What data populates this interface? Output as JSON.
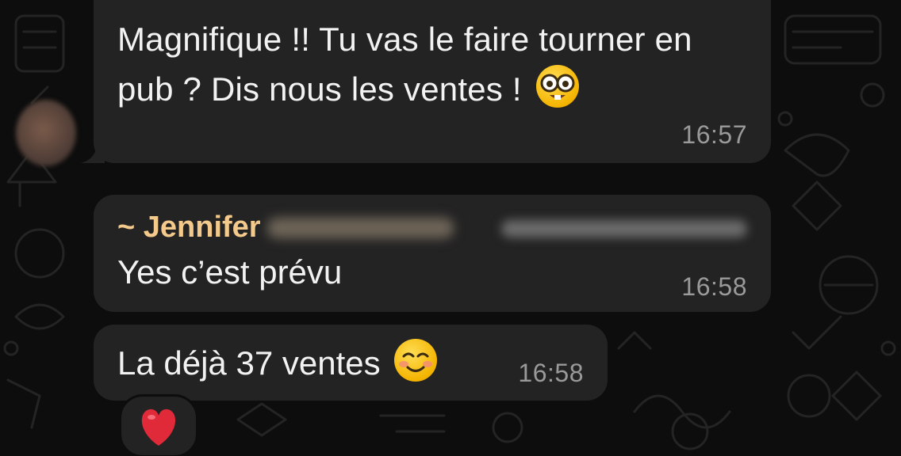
{
  "messages": [
    {
      "text": "Magnifique !! Tu vas le faire tourner en pub ? Dis nous les ventes !",
      "emoji": "nerd-face-emoji",
      "time": "16:57"
    },
    {
      "sender": "~ Jennifer",
      "text": "Yes c’est prévu",
      "time": "16:58"
    },
    {
      "text": "La déjà 37 ventes",
      "emoji": "smiling-face-emoji",
      "time": "16:58",
      "reaction": "red-heart-emoji"
    }
  ],
  "colors": {
    "background": "#0d0d0d",
    "bubble": "#232323",
    "sender_name": "#f4c98c",
    "timestamp": "#9a9a9a",
    "text": "#f2f2f2"
  }
}
